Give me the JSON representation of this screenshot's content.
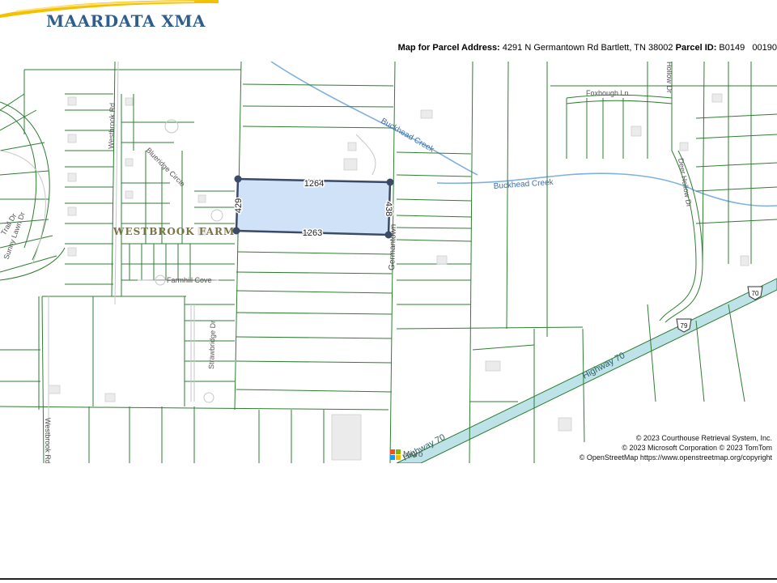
{
  "header": {
    "logo_text": "MAARDATA XMA",
    "address_prefix": "Map for Parcel Address:",
    "address_value": "4291 N Germantown Rd Bartlett, TN 38002",
    "parcel_prefix": "Parcel ID:",
    "parcel_value": "B0149   00190"
  },
  "map": {
    "parcel": {
      "top_edge": "1264",
      "bottom_edge": "1263",
      "left_edge": "429",
      "right_edge": "438",
      "fill_color": "#cfe2f7",
      "outline_color": "#3b4a66"
    },
    "labels": {
      "subdivision": "WESTBROOK FARM",
      "creek_1": "Buckhead Creek",
      "creek_2": "Buckhead Creek",
      "germantown": "Germantown",
      "highway_70_main": "Highway 70",
      "highway_70_lower": "Highway 70",
      "westbrook_rd": "Westbrook Rd",
      "westbrook_rd_lower": "Westbrook Rd",
      "farmhill_cove": "Farmhill Cove",
      "strawbridge": "Strawbridge Dr",
      "blueridge": "Blueridge Circle",
      "sunny_lawn": "Sunny Lawn Dr",
      "trail_dr": "Trail Dr",
      "foxbough": "Foxbough Ln",
      "deer_hollow": "Deer Hollow Dr",
      "hollow_dr": "Hollow Dr",
      "shield_79": "79",
      "shield_70": "70"
    },
    "colors": {
      "parcel_line": "#2e7d32",
      "water": "#6fa8dc",
      "highway_fill": "#bde3e8"
    }
  },
  "credits": {
    "line1": "© 2023 Courthouse Retrieval System, Inc.",
    "line2": "© 2023 Microsoft Corporation © 2023 TomTom",
    "line3": "© OpenStreetMap https://www.openstreetmap.org/copyright",
    "ms_text": "Micro"
  }
}
